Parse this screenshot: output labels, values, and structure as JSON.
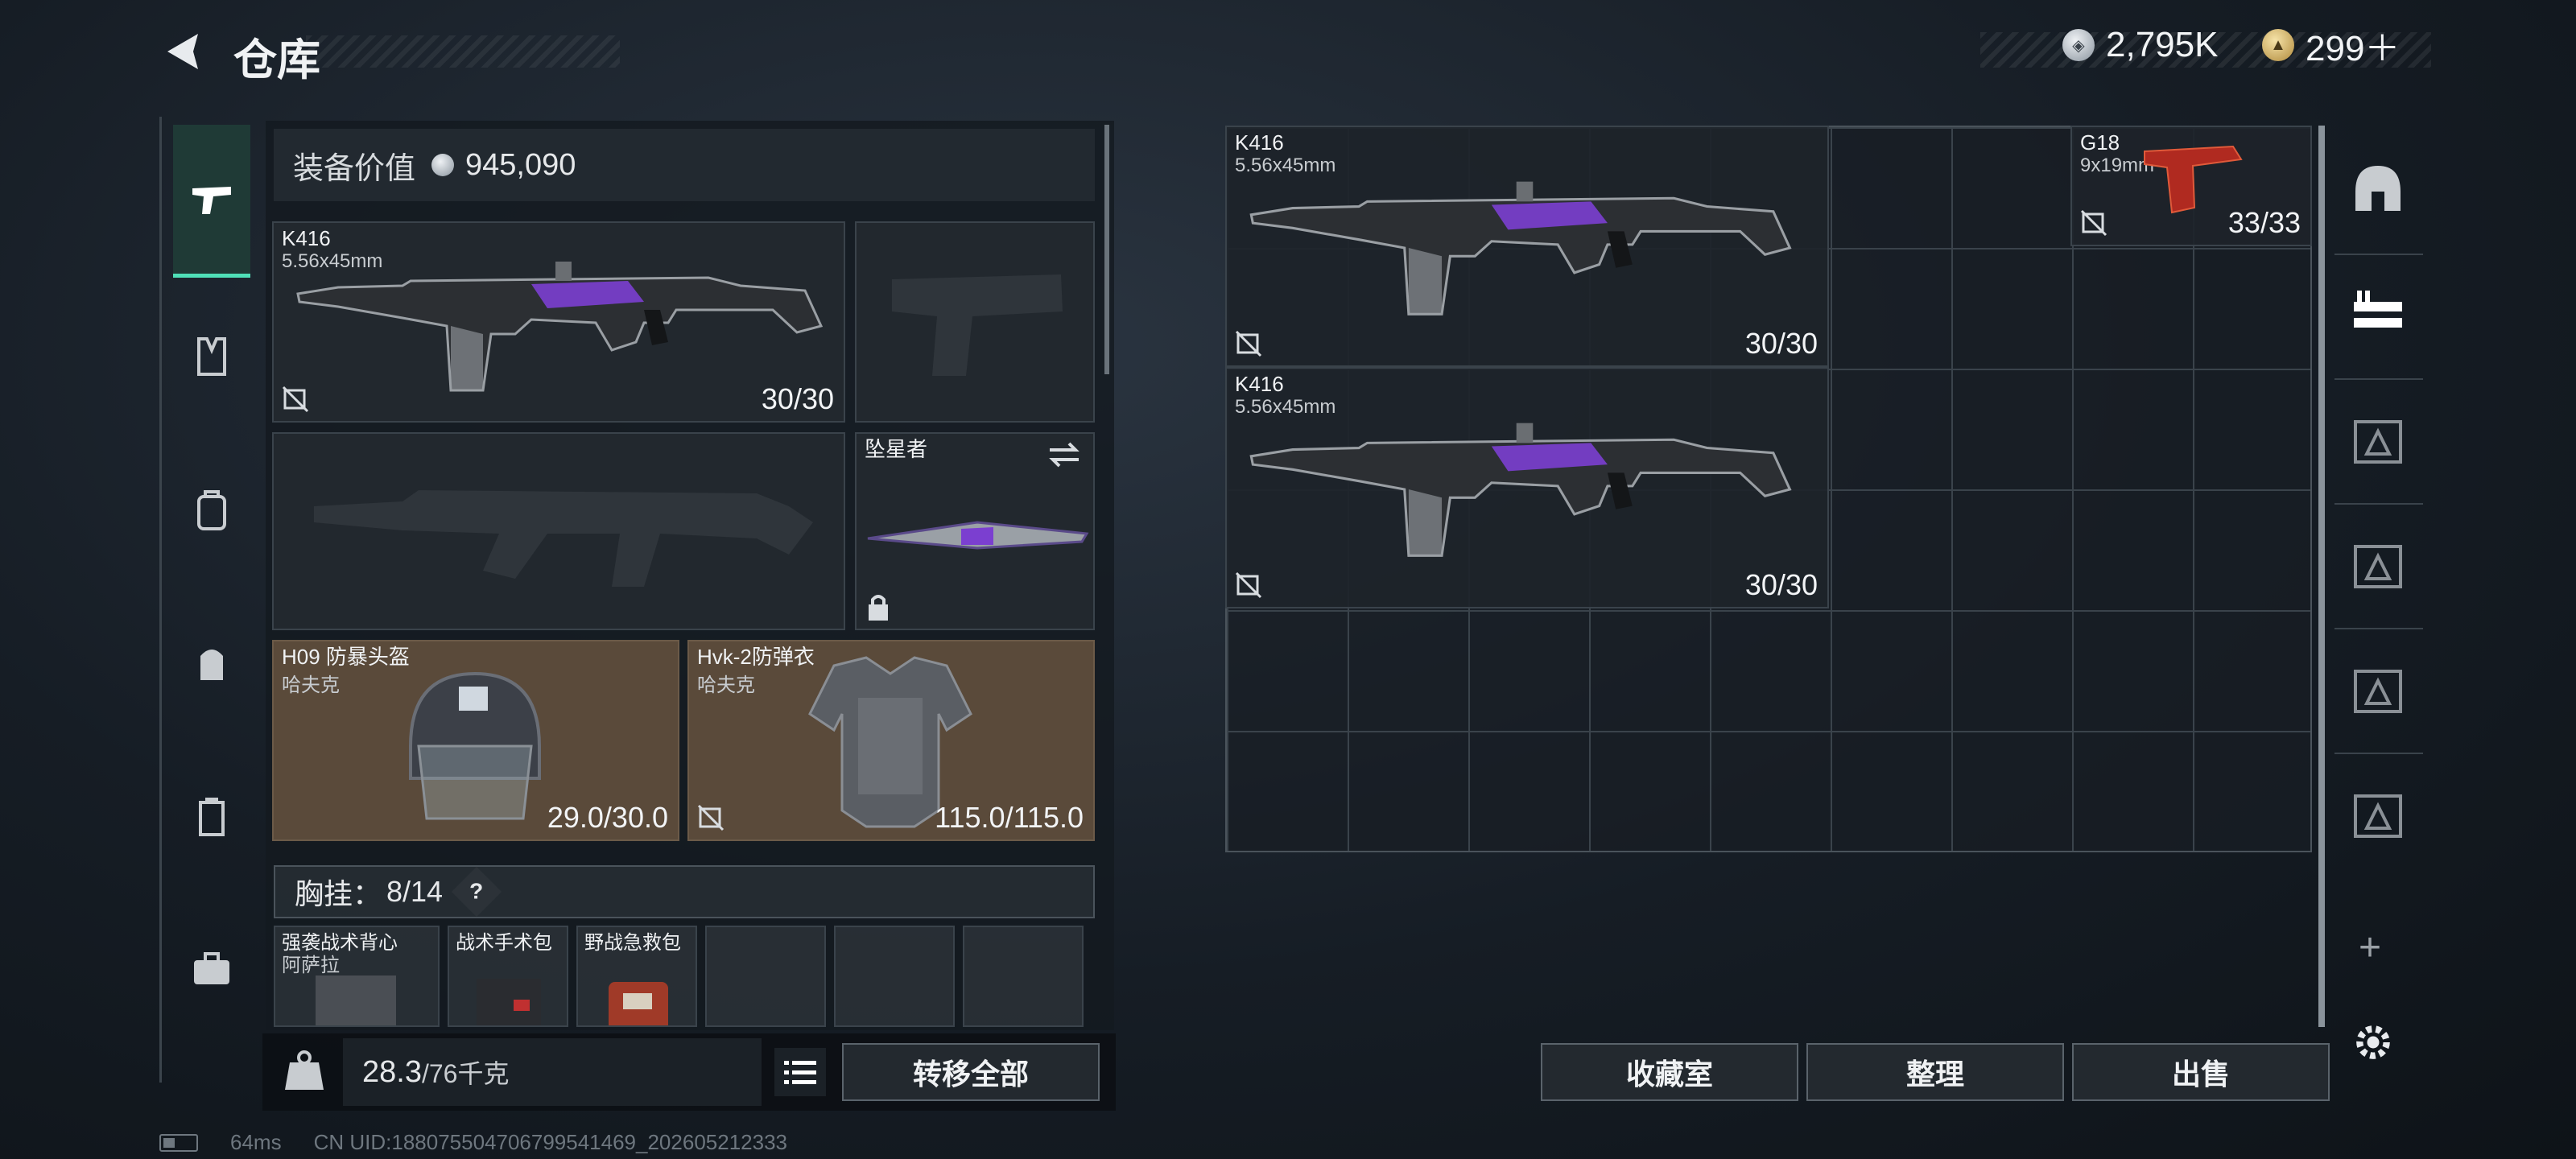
{
  "header": {
    "title": "仓库",
    "currency_silver": "2,795K",
    "currency_gold": "299＋"
  },
  "equipment": {
    "value_label": "装备价值",
    "value": "945,090",
    "primary_weapon": {
      "name": "K416",
      "caliber": "5.56x45mm",
      "ammo": "30/30"
    },
    "melee": {
      "name": "坠星者"
    },
    "helmet": {
      "name": "H09 防暴头盔",
      "brand": "哈夫克",
      "durability": "29.0/30.0"
    },
    "armor": {
      "name": "Hvk-2防弹衣",
      "brand": "哈夫克",
      "durability": "115.0/115.0"
    },
    "chest_rig": {
      "label": "胸挂：",
      "count": "8/14",
      "help": "?"
    },
    "rig_items": [
      {
        "name": "强袭战术背心",
        "sub": "阿萨拉"
      },
      {
        "name": "战术手术包",
        "sub": ""
      },
      {
        "name": "野战急救包",
        "sub": ""
      }
    ],
    "weight": "28.3",
    "weight_max": "/76千克",
    "transfer_all": "转移全部"
  },
  "storage": {
    "items": [
      {
        "name": "K416",
        "caliber": "5.56x45mm",
        "ammo": "30/30"
      },
      {
        "name": "K416",
        "caliber": "5.56x45mm",
        "ammo": "30/30"
      },
      {
        "name": "G18",
        "caliber": "9x19mm",
        "ammo": "33/33"
      }
    ],
    "buttons": {
      "collection": "收藏室",
      "sort": "整理",
      "sell": "出售"
    },
    "add": "+"
  },
  "status_bar": {
    "ping": "64ms",
    "uid": "CN UID:18807550470679954146‌9_202605212333"
  },
  "colors": {
    "accent": "#4fe0b8",
    "weapon_purple": "#7b3fd0",
    "brown_slot": "#5a4a3a"
  }
}
